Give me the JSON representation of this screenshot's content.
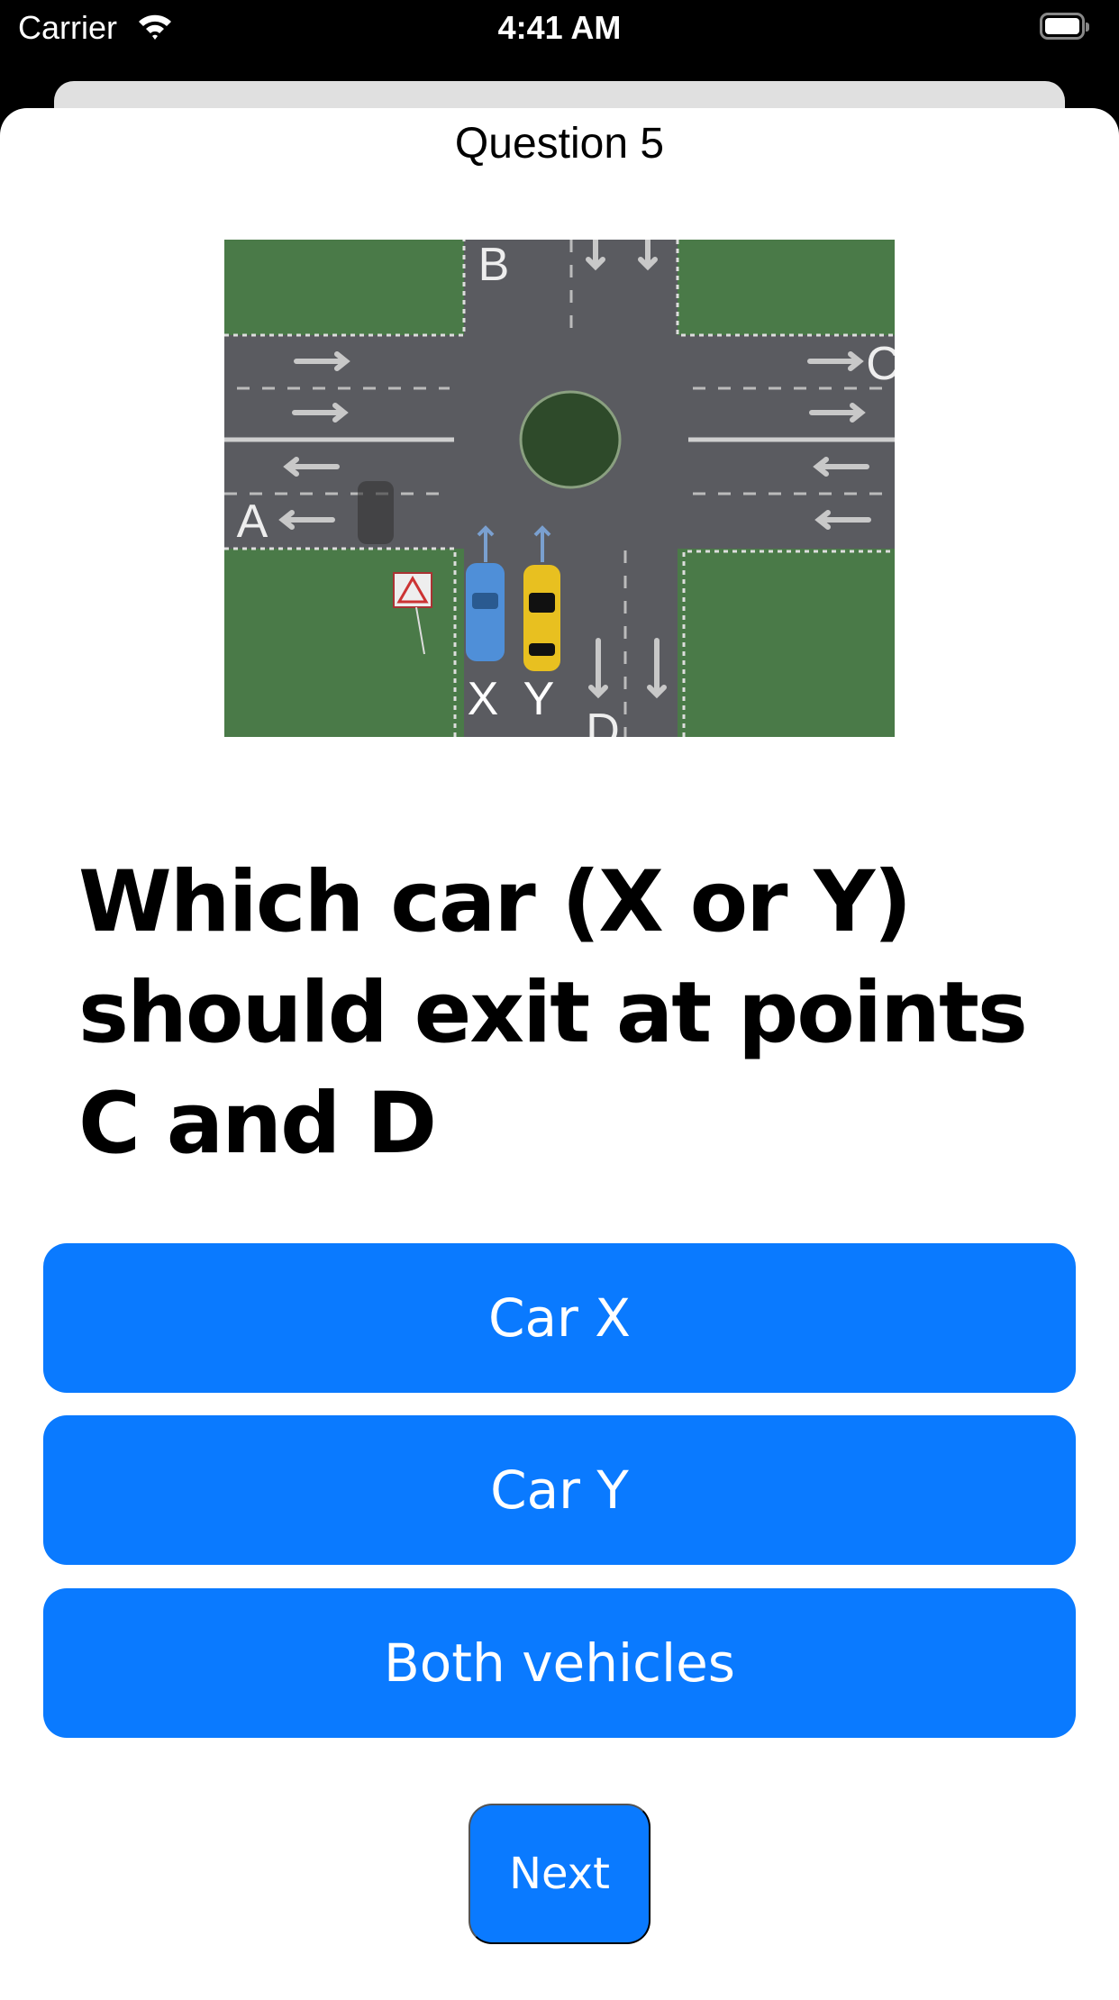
{
  "status_bar": {
    "carrier": "Carrier",
    "time": "4:41 AM"
  },
  "header": {
    "title": "Question 5"
  },
  "image": {
    "labels": {
      "a": "A",
      "b": "B",
      "c": "C",
      "d": "D",
      "x": "X",
      "y": "Y"
    }
  },
  "question": {
    "text": "Which car (X or Y) should exit at points C and D"
  },
  "options": [
    {
      "label": "Car X"
    },
    {
      "label": "Car Y"
    },
    {
      "label": "Both vehicles"
    }
  ],
  "next_label": "Next",
  "colors": {
    "accent": "#0a7aff",
    "grass": "#4a7a48",
    "road": "#5a5b60"
  }
}
